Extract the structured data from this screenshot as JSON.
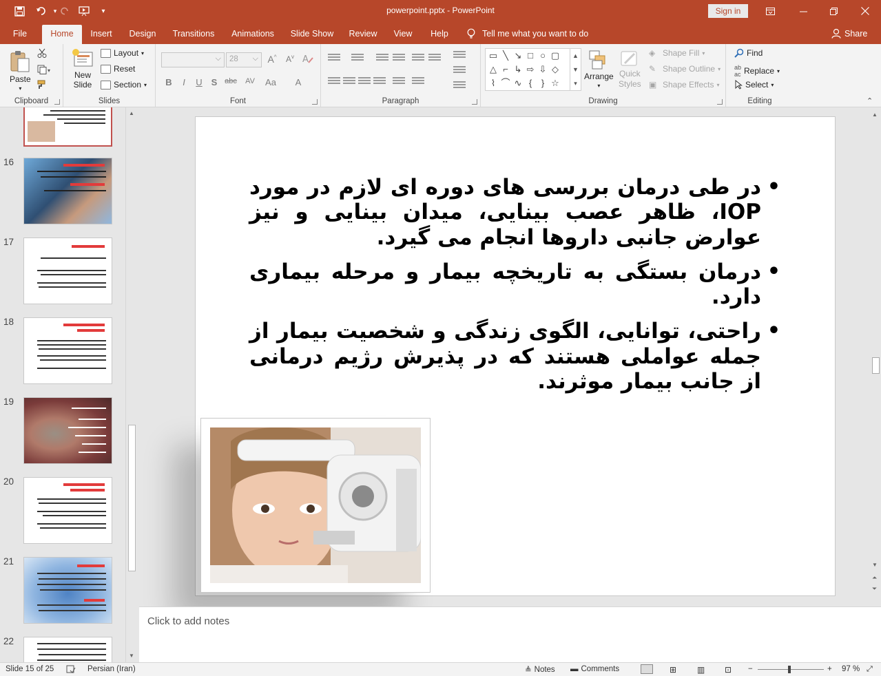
{
  "window": {
    "title": "powerpoint.pptx  -  PowerPoint",
    "signin": "Sign in"
  },
  "tabs": [
    "File",
    "Home",
    "Insert",
    "Design",
    "Transitions",
    "Animations",
    "Slide Show",
    "Review",
    "View",
    "Help"
  ],
  "active_tab": "Home",
  "tell_me": "Tell me what you want to do",
  "share": "Share",
  "ribbon": {
    "clipboard": {
      "label": "Clipboard",
      "paste": "Paste"
    },
    "slides": {
      "label": "Slides",
      "new_slide": "New",
      "new_slide2": "Slide",
      "layout": "Layout",
      "reset": "Reset",
      "section": "Section"
    },
    "font": {
      "label": "Font",
      "size": "28",
      "bold": "B",
      "italic": "I",
      "underline": "U",
      "shadow": "S",
      "strike": "abc",
      "spacing": "AV",
      "case": "Aa",
      "color": "A"
    },
    "paragraph": {
      "label": "Paragraph"
    },
    "drawing": {
      "label": "Drawing",
      "arrange": "Arrange",
      "quick_styles": "Quick",
      "quick_styles2": "Styles",
      "shape_fill": "Shape Fill",
      "shape_outline": "Shape Outline",
      "shape_effects": "Shape Effects"
    },
    "editing": {
      "label": "Editing",
      "find": "Find",
      "replace": "Replace",
      "select": "Select"
    }
  },
  "thumbnails": [
    {
      "num": "16"
    },
    {
      "num": "17"
    },
    {
      "num": "18"
    },
    {
      "num": "19"
    },
    {
      "num": "20"
    },
    {
      "num": "21"
    },
    {
      "num": "22"
    }
  ],
  "slide": {
    "bullets": [
      "در طی درمان بررسی های دوره ای لازم در مورد IOP، ظاهر عصب بینایی، میدان بینایی و نیز عوارض جانبی داروها انجام می گیرد.",
      "درمان بستگی به تاریخچه بیمار و مرحله بیماری دارد.",
      "راحتی، توانایی، الگوی زندگی و شخصیت بیمار از جمله عواملی هستند که در پذیرش رژیم درمانی از جانب بیمار موثرند."
    ]
  },
  "notes_placeholder": "Click to add notes",
  "status": {
    "slide": "Slide 15 of 25",
    "language": "Persian (Iran)",
    "notes": "Notes",
    "comments": "Comments",
    "zoom": "97 %"
  },
  "colors": {
    "accent": "#b7472a",
    "ribbon_bg": "#f3f3f3",
    "panel_bg": "#e6e6e6"
  }
}
